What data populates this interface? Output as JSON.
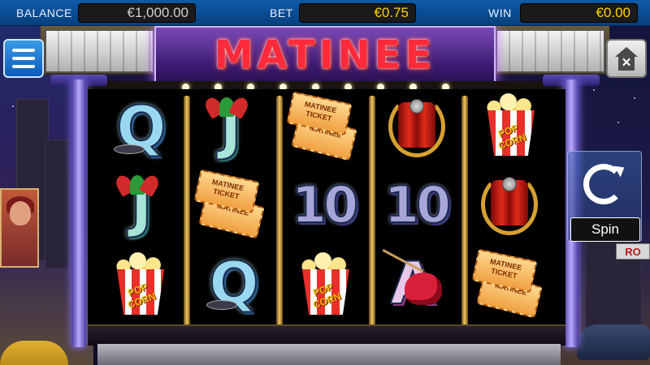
{
  "status_bar": {
    "balance_label": "BALANCE",
    "balance_value": "€1,000.00",
    "bet_label": "BET",
    "bet_value": "€0.75",
    "win_label": "WIN",
    "win_value": "€0.00"
  },
  "game": {
    "title": "MATINEE",
    "spin_label": "Spin"
  },
  "reels": [
    [
      "Q",
      "J",
      "popcorn"
    ],
    [
      "J",
      "ticket",
      "Q"
    ],
    [
      "ticket",
      "10",
      "popcorn"
    ],
    [
      "microphone",
      "10",
      "A"
    ],
    [
      "popcorn",
      "microphone",
      "ticket"
    ]
  ],
  "symbol_text": {
    "ticket_line1": "MATINEE",
    "ticket_line2": "TICKET",
    "popcorn": "POP CORN",
    "q": "Q",
    "j": "J",
    "ten": "10",
    "a": "A"
  },
  "colors": {
    "accent_blue": "#0e5aa8",
    "value_yellow": "#ffd400",
    "title_red": "#ff2a3a",
    "marquee_purple": "#7a4ab8"
  },
  "icons": {
    "menu": "hamburger-icon",
    "home": "home-close-icon",
    "spin": "spin-refresh-icon"
  }
}
